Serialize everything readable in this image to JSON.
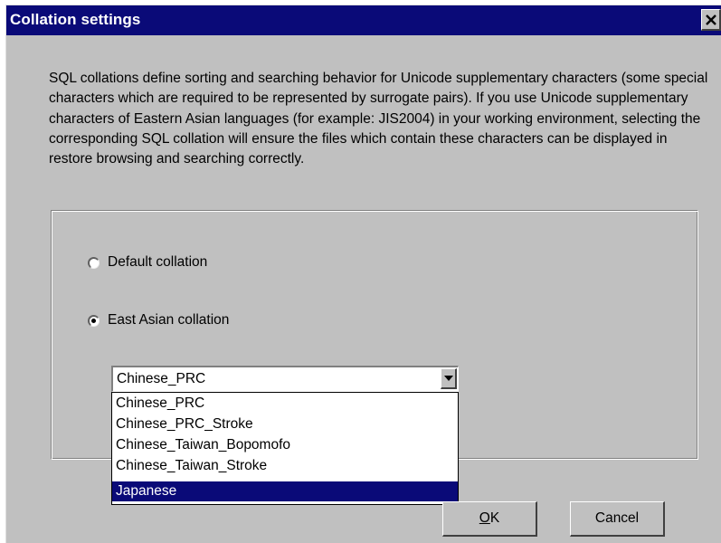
{
  "dialog": {
    "title": "Collation settings",
    "close_glyph": "✕",
    "description": "SQL collations define sorting and searching behavior for Unicode supplementary characters (some special characters which are required to be represented by surrogate pairs).  If you use Unicode supplementary characters of Eastern Asian languages (for example:  JIS2004) in your working environment, selecting the corresponding SQL collation will ensure the files which contain these characters can be displayed in restore browsing and searching correctly."
  },
  "options": {
    "default_label": "Default collation",
    "default_selected": false,
    "east_asian_label": "East Asian collation",
    "east_asian_selected": true
  },
  "collation_combo": {
    "value": "Chinese_PRC",
    "items": [
      "Chinese_PRC",
      "Chinese_PRC_Stroke",
      "Chinese_Taiwan_Bopomofo",
      "Chinese_Taiwan_Stroke",
      "Japanese"
    ],
    "highlighted": "Japanese"
  },
  "buttons": {
    "ok_mnemonic": "O",
    "ok_rest": "K",
    "cancel_label": "Cancel"
  },
  "colors": {
    "titlebar": "#0a0a78",
    "face": "#c0c0c0",
    "highlight": "#0a0a78"
  }
}
